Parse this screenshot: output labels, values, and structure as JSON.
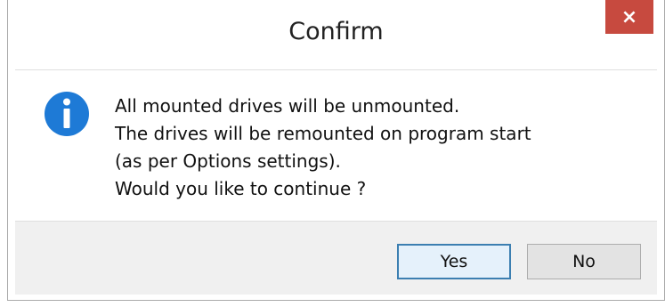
{
  "dialog": {
    "title": "Confirm",
    "close_label": "×"
  },
  "message": {
    "icon": "info-icon",
    "lines": [
      "All mounted drives will be unmounted.",
      "The drives will be remounted on program start",
      "(as per Options settings).",
      "Would you like to continue ?"
    ]
  },
  "buttons": {
    "yes_label": "Yes",
    "no_label": "No"
  },
  "colors": {
    "close_button": "#c74a3f",
    "info_icon": "#1e7ad6",
    "footer_background": "#f0f0f0",
    "default_button_border": "#3c7fb1"
  }
}
